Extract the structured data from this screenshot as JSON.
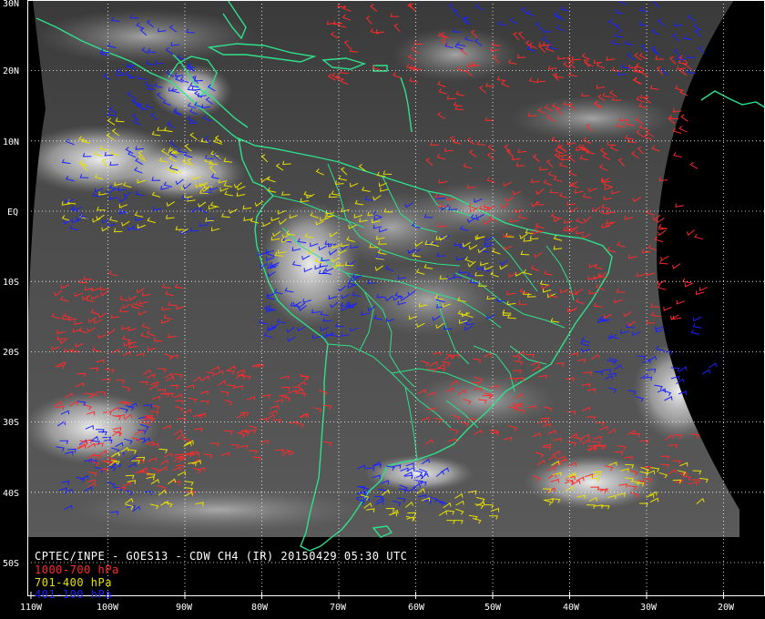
{
  "title": "CPTEC/INPE - GOES13 - CDW CH4 (IR) 20150429 05:30 UTC",
  "legend": [
    {
      "label": "1000-700 hPa",
      "color": "#ff2a2a"
    },
    {
      "label": "701-400 hPa",
      "color": "#e8e000"
    },
    {
      "label": "401-100 hPa",
      "color": "#1a22ff"
    }
  ],
  "colors": {
    "background": "#000000",
    "coastline": "#2ee08c",
    "grid": "#ffffff",
    "tick_text": "#ffffff"
  },
  "lat_labels": [
    "30N",
    "20N",
    "10N",
    "EQ",
    "10S",
    "20S",
    "30S",
    "40S",
    "50S"
  ],
  "lon_labels": [
    "110W",
    "100W",
    "90W",
    "80W",
    "70W",
    "60W",
    "50W",
    "40W",
    "30W",
    "20W"
  ],
  "wind_regions": [
    {
      "lon": [
        -99,
        -86
      ],
      "lat": [
        11,
        20
      ],
      "layer": 2,
      "count": 40
    },
    {
      "lon": [
        -105,
        -85
      ],
      "lat": [
        -3,
        13
      ],
      "layer": 1,
      "count": 70
    },
    {
      "lon": [
        -105,
        -85
      ],
      "lat": [
        -3,
        10
      ],
      "layer": 2,
      "count": 60
    },
    {
      "lon": [
        -107,
        -90
      ],
      "lat": [
        -28,
        -9
      ],
      "layer": 0,
      "count": 110
    },
    {
      "lon": [
        -107,
        -95
      ],
      "lat": [
        -43,
        -27
      ],
      "layer": 2,
      "count": 50
    },
    {
      "lon": [
        -104,
        -88
      ],
      "lat": [
        -40,
        -28
      ],
      "layer": 0,
      "count": 70
    },
    {
      "lon": [
        -100,
        -88
      ],
      "lat": [
        -42,
        -33
      ],
      "layer": 1,
      "count": 30
    },
    {
      "lon": [
        -90,
        -72
      ],
      "lat": [
        -35,
        -22
      ],
      "layer": 0,
      "count": 70
    },
    {
      "lon": [
        -80,
        -67
      ],
      "lat": [
        -18,
        -4
      ],
      "layer": 2,
      "count": 75
    },
    {
      "lon": [
        -78,
        -62
      ],
      "lat": [
        -8,
        6
      ],
      "layer": 1,
      "count": 60
    },
    {
      "lon": [
        -66,
        -48
      ],
      "lat": [
        -17,
        2
      ],
      "layer": 2,
      "count": 60
    },
    {
      "lon": [
        -60,
        -40
      ],
      "lat": [
        -16,
        -3
      ],
      "layer": 1,
      "count": 55
    },
    {
      "lon": [
        -58,
        -34
      ],
      "lat": [
        -3,
        10
      ],
      "layer": 0,
      "count": 70
    },
    {
      "lon": [
        -62,
        -40
      ],
      "lat": [
        12,
        25
      ],
      "layer": 0,
      "count": 50
    },
    {
      "lon": [
        -42,
        -24
      ],
      "lat": [
        10,
        22
      ],
      "layer": 0,
      "count": 65
    },
    {
      "lon": [
        -48,
        -22
      ],
      "lat": [
        -16,
        10
      ],
      "layer": 0,
      "count": 110
    },
    {
      "lon": [
        -38,
        -21
      ],
      "lat": [
        -27,
        -15
      ],
      "layer": 2,
      "count": 45
    },
    {
      "lon": [
        -34,
        -22
      ],
      "lat": [
        19,
        30
      ],
      "layer": 2,
      "count": 30
    },
    {
      "lon": [
        -56,
        -40
      ],
      "lat": [
        22,
        30
      ],
      "layer": 2,
      "count": 25
    },
    {
      "lon": [
        -72,
        -60
      ],
      "lat": [
        18,
        30
      ],
      "layer": 0,
      "count": 25
    },
    {
      "lon": [
        -60,
        -36
      ],
      "lat": [
        -34,
        -20
      ],
      "layer": 0,
      "count": 80
    },
    {
      "lon": [
        -45,
        -24
      ],
      "lat": [
        -40,
        -31
      ],
      "layer": 0,
      "count": 60
    },
    {
      "lon": [
        -44,
        -22
      ],
      "lat": [
        -42,
        -36
      ],
      "layer": 1,
      "count": 40
    },
    {
      "lon": [
        -68,
        -56
      ],
      "lat": [
        -42,
        -36
      ],
      "layer": 2,
      "count": 45
    },
    {
      "lon": [
        -68,
        -50
      ],
      "lat": [
        -44,
        -40
      ],
      "layer": 1,
      "count": 30
    },
    {
      "lon": [
        -100,
        -88
      ],
      "lat": [
        17,
        28
      ],
      "layer": 2,
      "count": 30
    },
    {
      "lon": [
        -88,
        -76
      ],
      "lat": [
        -2,
        8
      ],
      "layer": 1,
      "count": 30
    }
  ]
}
